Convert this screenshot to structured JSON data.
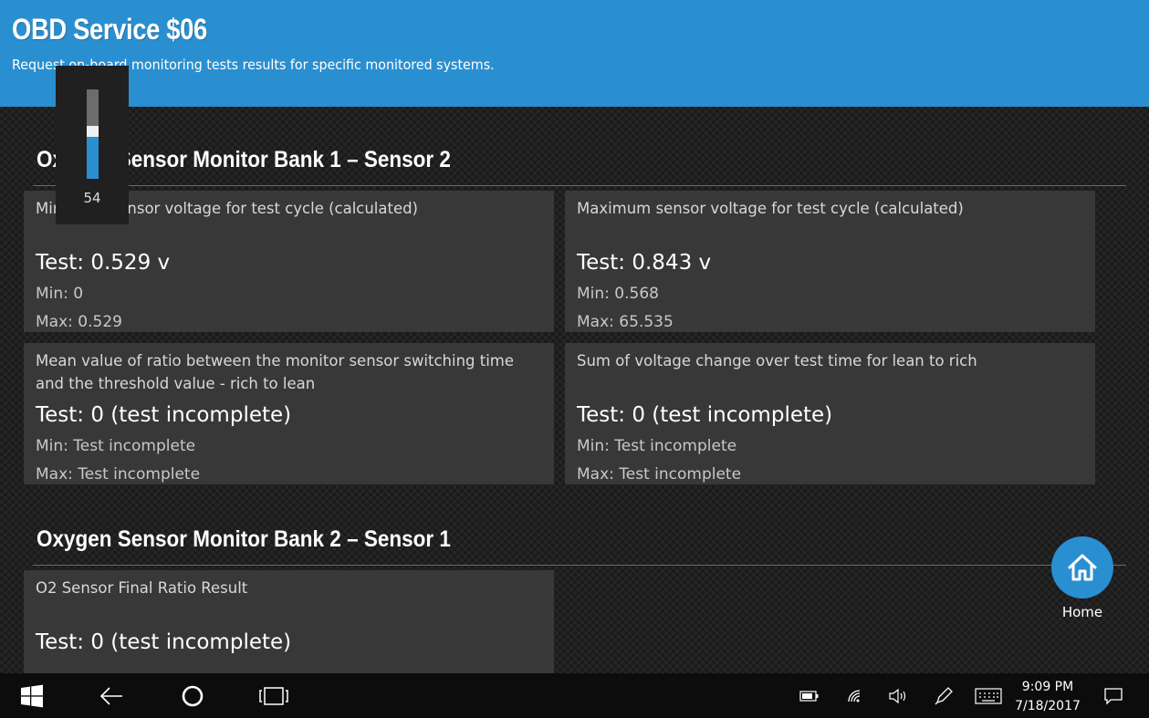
{
  "header": {
    "title": "OBD Service $06",
    "subtitle": "Request on-board monitoring tests results for specific monitored systems."
  },
  "sections": [
    {
      "title": "Oxygen Sensor Monitor Bank 1 – Sensor 2",
      "cards": [
        {
          "label": "Minimum sensor voltage for test cycle (calculated)",
          "test": "Test: 0.529 v",
          "min": "Min: 0",
          "max": "Max: 0.529"
        },
        {
          "label": "Maximum sensor voltage for test cycle (calculated)",
          "test": "Test: 0.843 v",
          "min": "Min: 0.568",
          "max": "Max: 65.535"
        },
        {
          "label": "Mean value of ratio between the monitor sensor switching time and the threshold value - rich to lean",
          "test": "Test: 0 (test incomplete)",
          "min": "Min: Test incomplete",
          "max": "Max: Test incomplete"
        },
        {
          "label": "Sum of voltage change over test time for lean to rich",
          "test": "Test: 0 (test incomplete)",
          "min": "Min: Test incomplete",
          "max": "Max: Test incomplete"
        }
      ]
    },
    {
      "title": "Oxygen Sensor Monitor Bank 2 – Sensor 1",
      "cards": [
        {
          "label": "O2 Sensor Final Ratio Result",
          "test": "Test: 0 (test incomplete)"
        }
      ]
    }
  ],
  "home_button": {
    "label": "Home",
    "icon": "home-icon"
  },
  "volume_popup": {
    "value": "54",
    "level_percent": 54
  },
  "taskbar": {
    "time": "9:09 PM",
    "date": "7/18/2017",
    "icons": [
      "windows-start-icon",
      "back-arrow-icon",
      "cortana-circle-icon",
      "task-view-icon",
      "battery-icon",
      "wifi-icon",
      "volume-icon",
      "pen-icon",
      "keyboard-icon",
      "action-center-icon"
    ]
  },
  "colors": {
    "accent": "#2a8fd0",
    "card": "#3a3a3a",
    "taskbar": "#0c0c0c"
  }
}
